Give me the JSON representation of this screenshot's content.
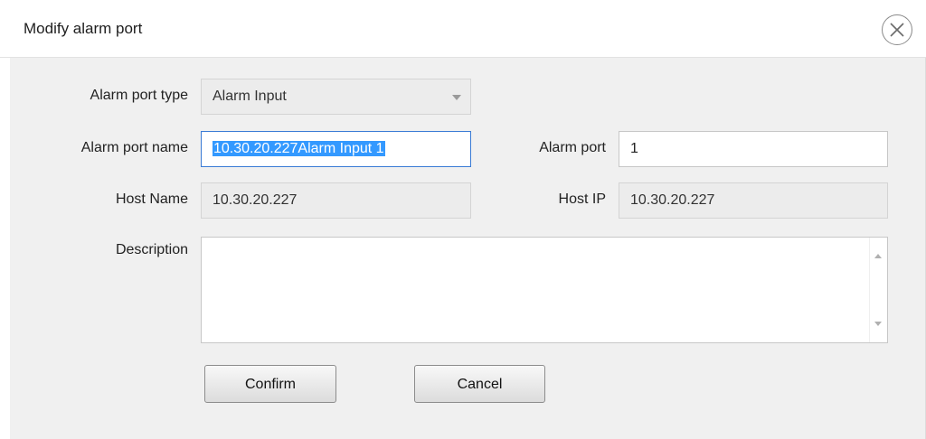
{
  "dialog": {
    "title": "Modify alarm port",
    "close_icon": "close-circle-icon"
  },
  "form": {
    "port_type": {
      "label": "Alarm port type",
      "value": "Alarm Input"
    },
    "port_name": {
      "label": "Alarm port name",
      "value": "10.30.20.227Alarm Input 1"
    },
    "alarm_port": {
      "label": "Alarm port",
      "value": "1"
    },
    "host_name": {
      "label": "Host Name",
      "value": "10.30.20.227"
    },
    "host_ip": {
      "label": "Host IP",
      "value": "10.30.20.227"
    },
    "description": {
      "label": "Description",
      "value": ""
    }
  },
  "buttons": {
    "confirm": "Confirm",
    "cancel": "Cancel"
  },
  "colors": {
    "selection": "#3399ff",
    "focus_border": "#3a7bd5",
    "dialog_bg": "#f0f0f0"
  }
}
